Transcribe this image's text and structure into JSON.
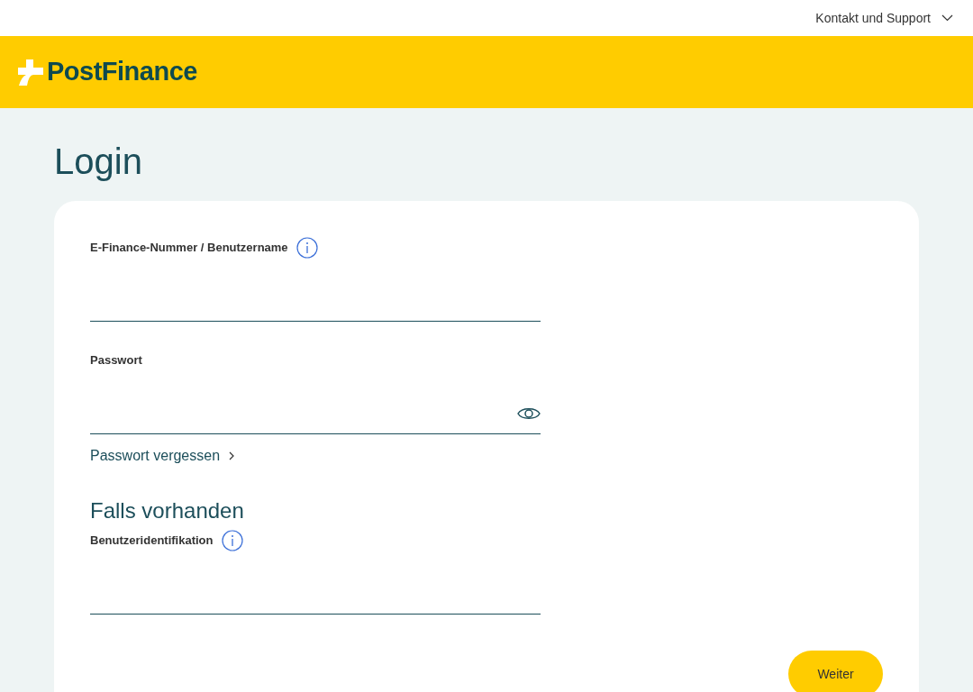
{
  "top_bar": {
    "support_link": "Kontakt und Support"
  },
  "header": {
    "logo_text": "PostFinance"
  },
  "page_title": "Login",
  "fields": [
    {
      "kind": "text",
      "label": "E-Finance-Nummer / Benutzername",
      "info": true
    },
    {
      "kind": "password",
      "label": "Passwort",
      "info": false
    }
  ],
  "forgot_link": "Passwort vergessen",
  "optional_heading": "Falls vorhanden",
  "optional_fields": [
    {
      "kind": "text",
      "label": "Benutzeridentifikation",
      "info": true
    }
  ],
  "submit_button": "Weiter"
}
